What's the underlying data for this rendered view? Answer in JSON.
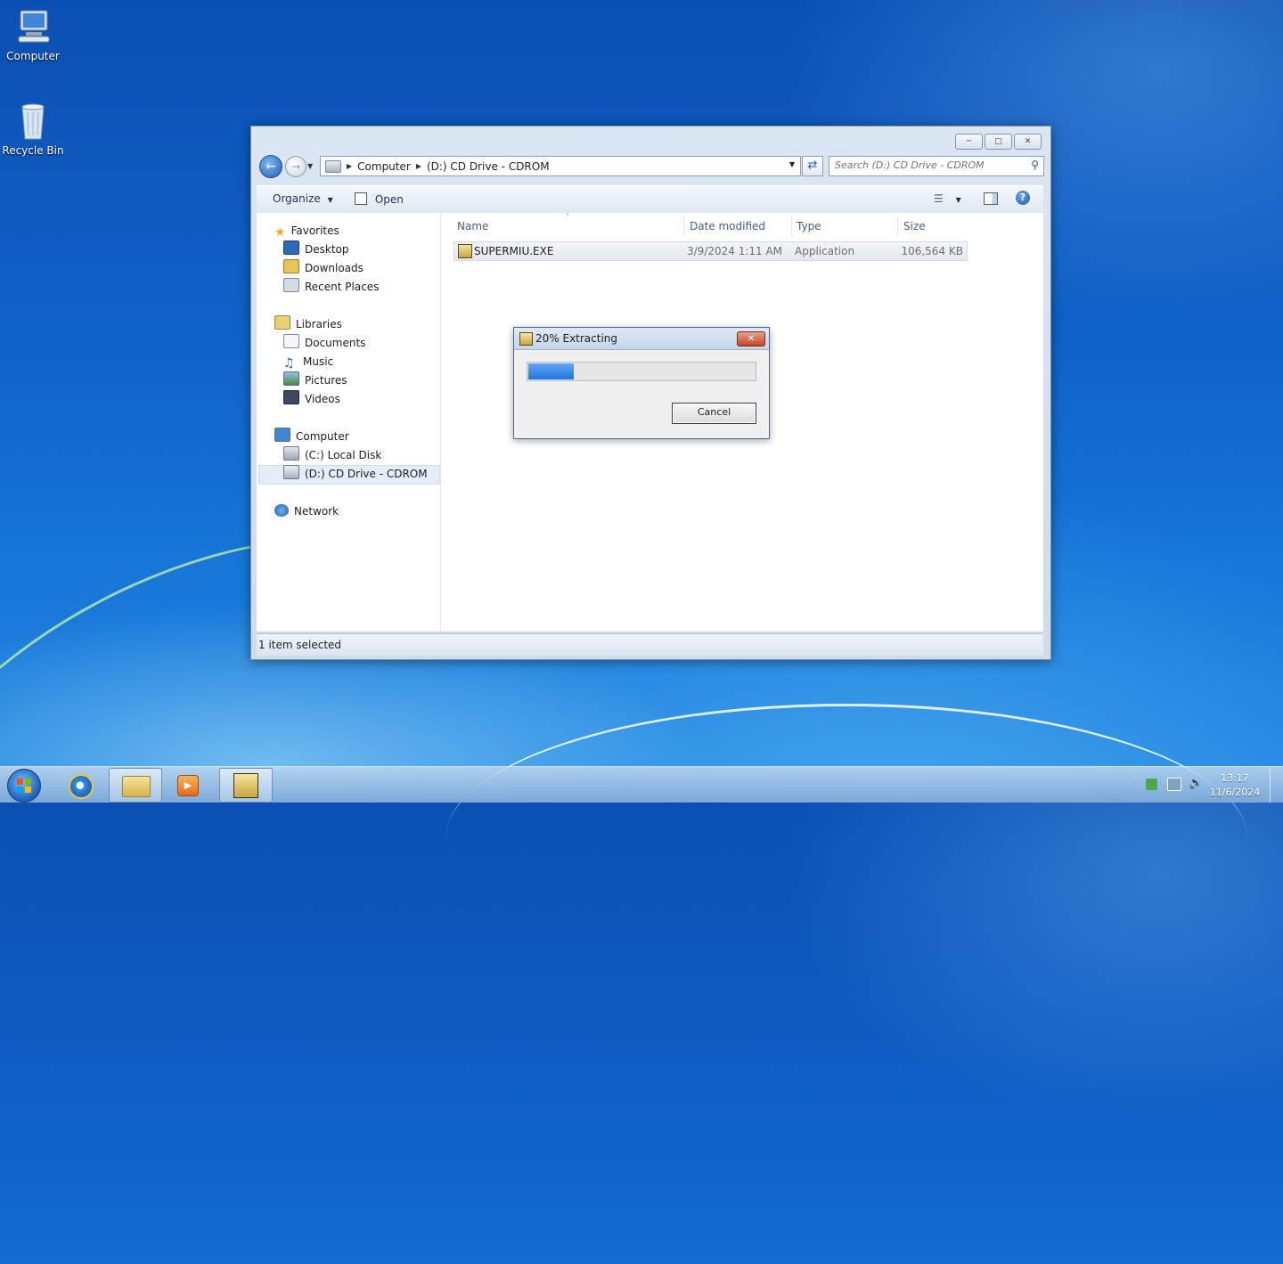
{
  "desktop": {
    "icons": [
      {
        "label": "Computer"
      },
      {
        "label": "Recycle Bin"
      }
    ]
  },
  "explorer": {
    "address": {
      "seg1": "Computer",
      "seg2": "(D:) CD Drive - CDROM"
    },
    "search_placeholder": "Search (D:) CD Drive - CDROM",
    "toolbar": {
      "organize": "Organize",
      "open": "Open"
    },
    "nav": {
      "favorites": "Favorites",
      "desktop": "Desktop",
      "downloads": "Downloads",
      "recent": "Recent Places",
      "libraries": "Libraries",
      "documents": "Documents",
      "music": "Music",
      "pictures": "Pictures",
      "videos": "Videos",
      "computer": "Computer",
      "local_disk": "(C:) Local Disk",
      "cd_drive": "(D:) CD Drive - CDROM",
      "network": "Network"
    },
    "columns": {
      "name": "Name",
      "date": "Date modified",
      "type": "Type",
      "size": "Size"
    },
    "files": [
      {
        "name": "SUPERMIU.EXE",
        "date": "3/9/2024 1:11 AM",
        "type": "Application",
        "size": "106,564 KB"
      }
    ],
    "status": "1 item selected"
  },
  "dialog": {
    "title": "20% Extracting",
    "progress_fraction": 0.2,
    "cancel": "Cancel"
  },
  "taskbar": {
    "time": "13:17",
    "date": "11/6/2024"
  },
  "colors": {
    "progress_fill": "#1f74de",
    "desktop_bg": "#1063c9"
  }
}
